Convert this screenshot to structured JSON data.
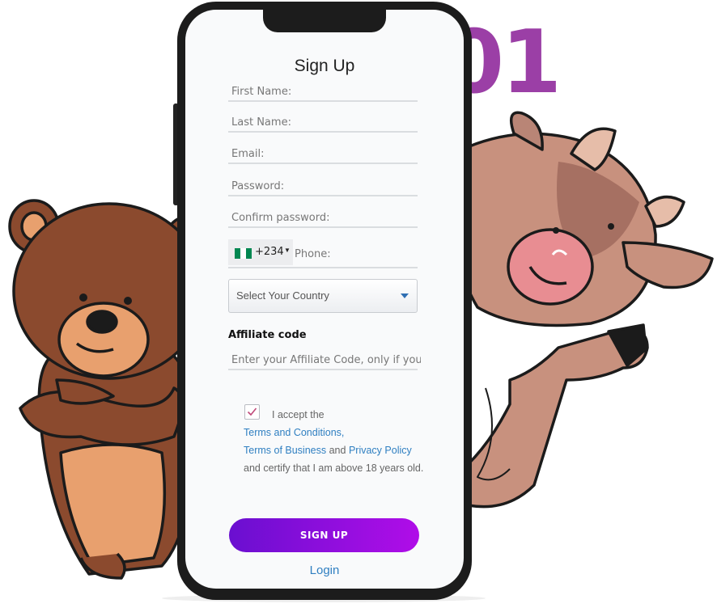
{
  "background_text": "01",
  "form": {
    "title": "Sign Up",
    "fields": {
      "first_name": "First Name:",
      "last_name": "Last Name:",
      "email": "Email:",
      "password": "Password:",
      "confirm_password": "Confirm password:",
      "phone": "Phone:"
    },
    "phone_code": "+234",
    "phone_flag_colors": [
      "#008751",
      "#ffffff",
      "#008751"
    ],
    "country_select": "Select Your Country",
    "affiliate_label": "Affiliate code",
    "affiliate_placeholder": "Enter your Affiliate Code, only if you have one",
    "terms": {
      "checked": true,
      "accept": "I accept the",
      "terms_link": "Terms and Conditions,",
      "business_link": "Terms of Business",
      "and": "and",
      "privacy_link": "Privacy Policy",
      "certify": "and certify that I am above 18 years old."
    },
    "signup_button": "SIGN UP",
    "login_link": "Login"
  },
  "colors": {
    "accent": "#9b3fa6",
    "button_start": "#6a0fd0",
    "button_end": "#b00de8",
    "link": "#2f7fc1"
  }
}
